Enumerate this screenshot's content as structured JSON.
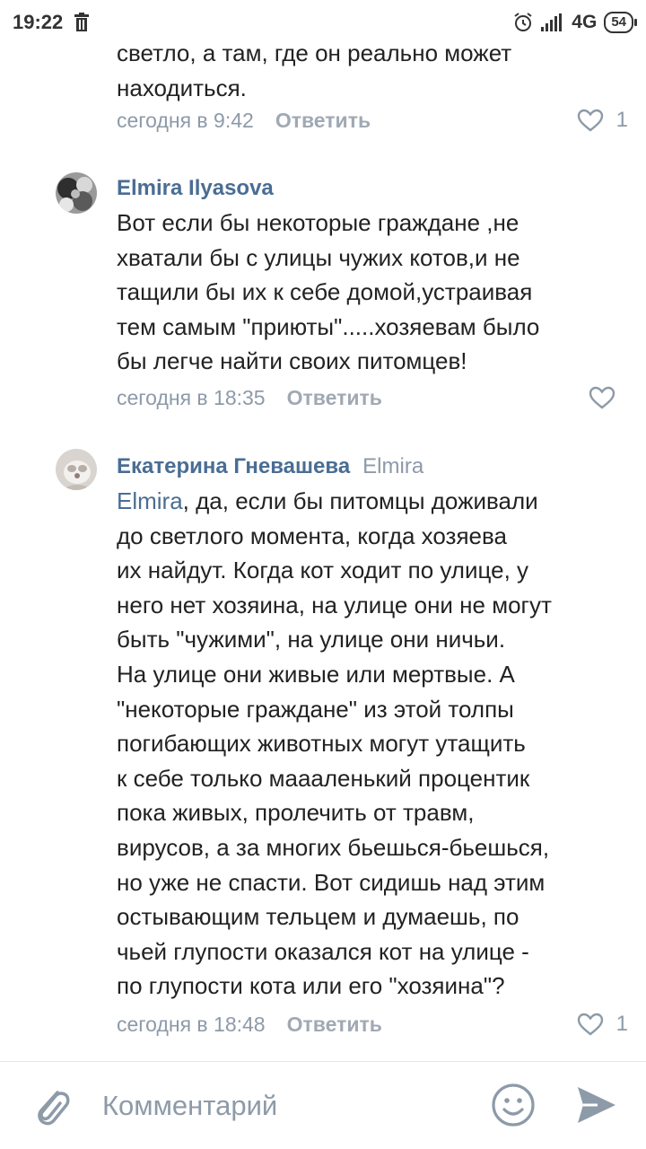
{
  "status_bar": {
    "time": "19:22",
    "network": "4G",
    "battery": "54"
  },
  "comments": [
    {
      "text": "светло, а там, где он реально может\nнаходиться.",
      "time": "сегодня в 9:42",
      "reply_label": "Ответить",
      "likes": "1"
    },
    {
      "author": "Elmira Ilyasova",
      "text": "Вот если бы некоторые граждане ,не\nхватали бы с улицы чужих котов,и не\nтащили бы их к себе домой,устраивая\nтем самым \"приюты\".....хозяевам было\nбы легче найти своих питомцев!",
      "time": "сегодня в 18:35",
      "reply_label": "Ответить",
      "likes": ""
    },
    {
      "author": "Екатерина Гневашева",
      "reply_to": "Elmira",
      "mention": "Elmira",
      "text": ", да, если бы питомцы доживали\nдо светлого момента, когда хозяева\nих найдут. Когда кот ходит по улице, у\nнего нет хозяина, на улице они не могут\nбыть \"чужими\", на улице они ничьи.\nНа улице они живые или мертвые. А\n\"некоторые граждане\" из этой толпы\nпогибающих животных могут утащить\nк себе только маааленький процентик\nпока живых, пролечить от травм,\nвирусов, а за многих бьешься-бьешься,\nно уже не спасти. Вот сидишь над этим\nостывающим тельцем и думаешь, по\nчьей глупости оказался кот на улице -\nпо глупости кота или его \"хозяина\"?",
      "time": "сегодня в 18:48",
      "reply_label": "Ответить",
      "likes": "1"
    }
  ],
  "composer": {
    "placeholder": "Комментарий"
  },
  "icons": {
    "trash": "trash-icon",
    "alarm": "alarm-icon",
    "signal": "signal-icon",
    "heart": "heart-icon",
    "attach": "paperclip-icon",
    "emoji": "emoji-icon",
    "send": "send-icon"
  },
  "colors": {
    "link": "#4a6d94",
    "muted": "#8d9aa8",
    "text": "#222222"
  }
}
